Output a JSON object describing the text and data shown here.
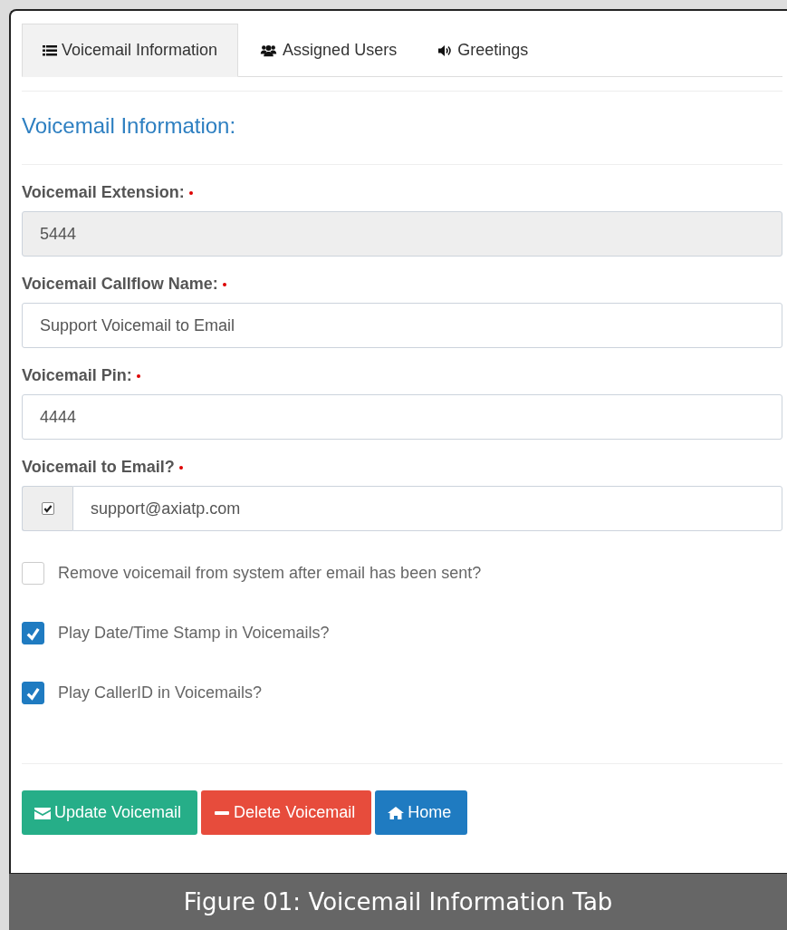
{
  "tabs": [
    {
      "label": "Voicemail Information",
      "kind": "list",
      "selected": true
    },
    {
      "label": "Assigned Users",
      "kind": "users",
      "selected": false
    },
    {
      "label": "Greetings",
      "kind": "sound",
      "selected": false
    }
  ],
  "heading": "Voicemail Information:",
  "fields": [
    {
      "label": "Voicemail Extension:",
      "required": true,
      "kind": "readonly",
      "value": "5444"
    },
    {
      "label": "Voicemail Callflow Name:",
      "required": true,
      "kind": "text",
      "value": "Support Voicemail to Email"
    },
    {
      "label": "Voicemail Pin:",
      "required": true,
      "kind": "text",
      "value": "4444"
    },
    {
      "label": "Voicemail to Email?",
      "required": true,
      "kind": "check-addon",
      "checked": true,
      "value": "support@axiatp.com"
    }
  ],
  "options": [
    {
      "label": "Remove voicemail from system after email has been sent?",
      "checked": false
    },
    {
      "label": "Play Date/Time Stamp in Voicemails?",
      "checked": true
    },
    {
      "label": "Play CallerID in Voicemails?",
      "checked": true
    }
  ],
  "buttons": [
    {
      "label": "Update Voicemail",
      "kind": "update"
    },
    {
      "label": "Delete Voicemail",
      "kind": "delete"
    },
    {
      "label": "Home",
      "kind": "home"
    }
  ],
  "caption": "Figure 01: Voicemail Information Tab"
}
